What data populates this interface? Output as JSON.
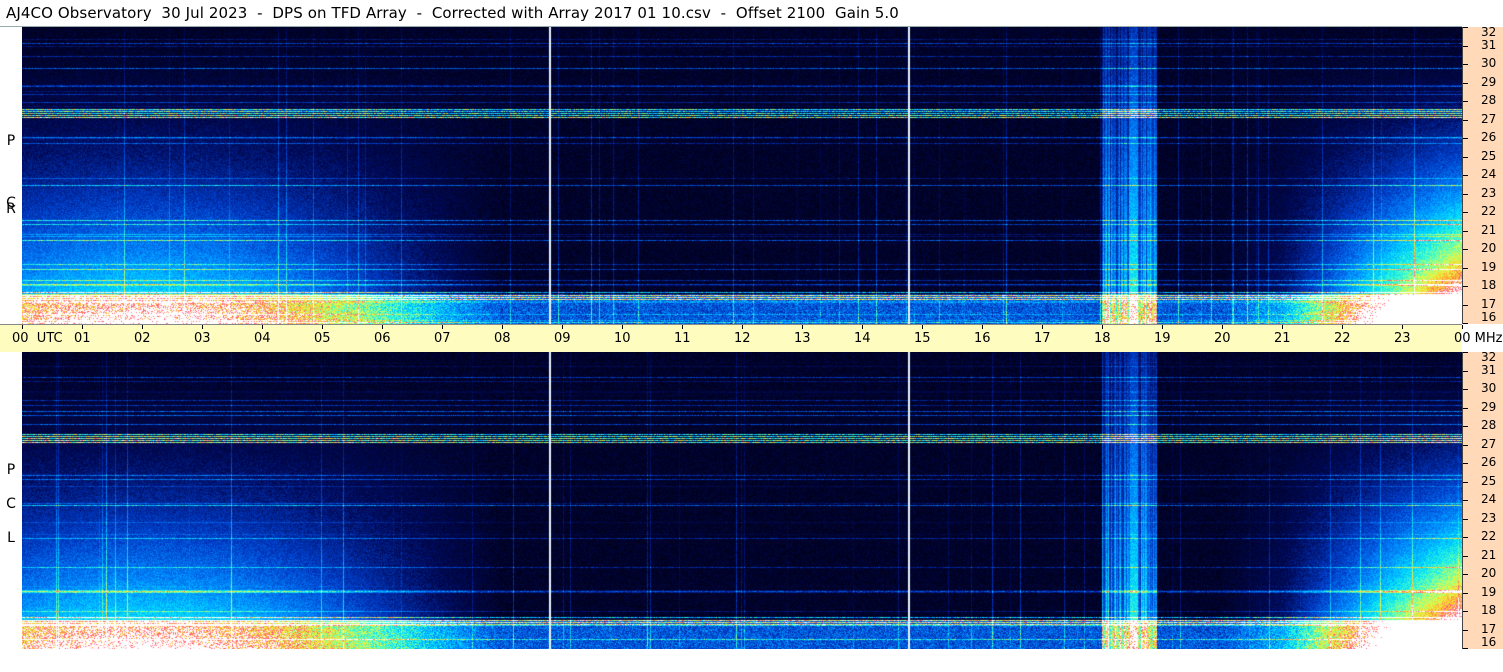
{
  "title": "AJ4CO Observatory  30 Jul 2023  -  DPS on TFD Array  -  Corrected with Array 2017 01 10.csv  -  Offset 2100  Gain 5.0",
  "panels": [
    {
      "pol_letters": [
        "P",
        "C",
        "R"
      ]
    },
    {
      "pol_letters": [
        "P",
        "C",
        "L"
      ]
    }
  ],
  "time_axis": {
    "hours": [
      "00",
      "01",
      "02",
      "03",
      "04",
      "05",
      "06",
      "07",
      "08",
      "09",
      "10",
      "11",
      "12",
      "13",
      "14",
      "15",
      "16",
      "17",
      "18",
      "19",
      "20",
      "21",
      "22",
      "23",
      "00"
    ],
    "start_suffix": "UTC",
    "end_suffix": "MHz"
  },
  "freq_axis": {
    "labels": [
      "32",
      "31",
      "30",
      "29",
      "28",
      "27",
      "26",
      "25",
      "24",
      "23",
      "22",
      "21",
      "20",
      "19",
      "18",
      "17",
      "16"
    ],
    "min_mhz": 16,
    "max_mhz": 32
  },
  "colors": {
    "axis_background": "#ffd9b8",
    "time_axis_background": "#fffcc0",
    "spectrogram_background": "#000020",
    "marker_line": "#e8f4ff"
  },
  "markers_utc_hours": [
    8.79,
    14.77
  ]
}
